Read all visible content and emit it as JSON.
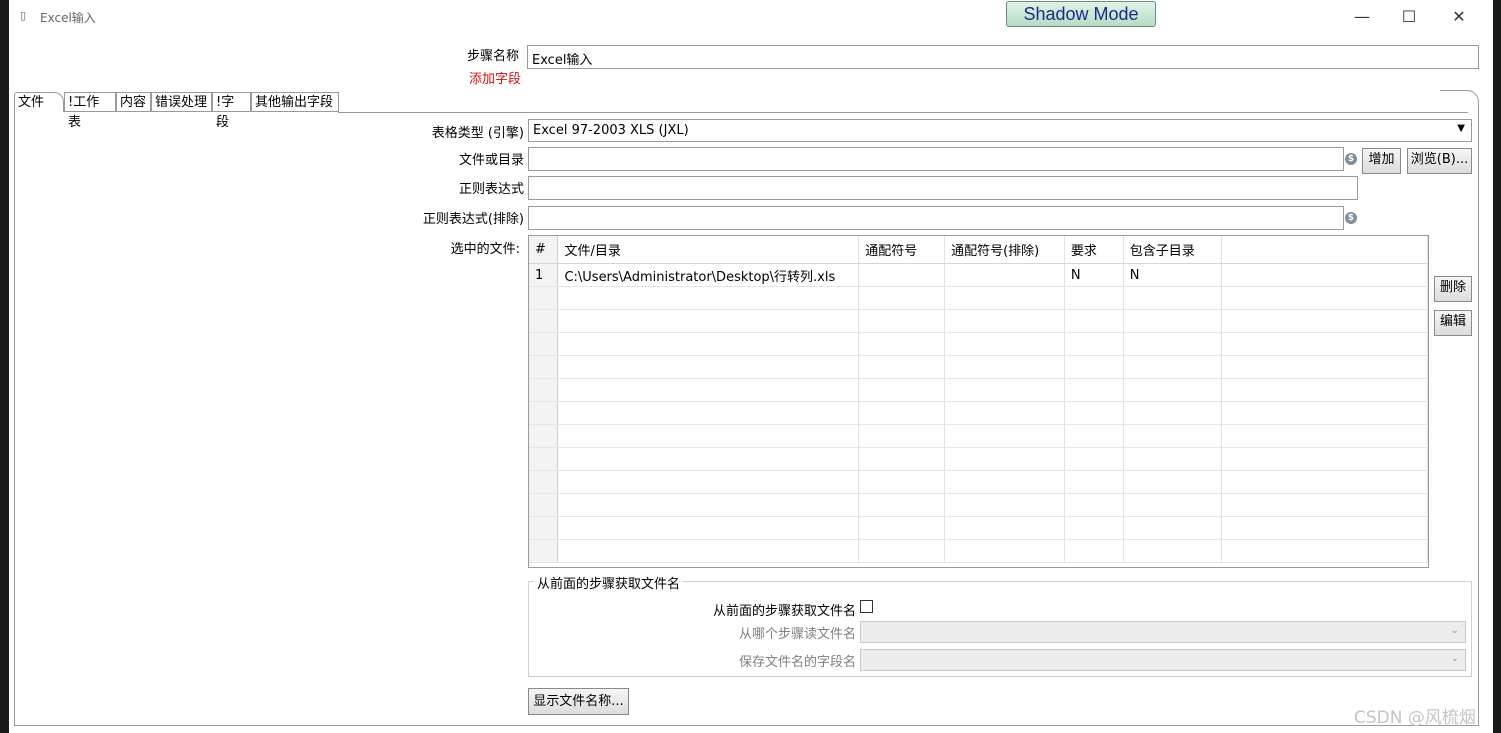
{
  "window": {
    "title": "Excel输入",
    "shadow_mode": "Shadow Mode",
    "minimize": "—",
    "maximize": "☐",
    "close": "✕"
  },
  "step": {
    "name_label": "步骤名称",
    "name_value": "Excel输入",
    "add_field": "添加字段"
  },
  "tabs": [
    {
      "label": "文件"
    },
    {
      "label": "!工作表"
    },
    {
      "label": "内容"
    },
    {
      "label": "错误处理"
    },
    {
      "label": "!字段"
    },
    {
      "label": "其他输出字段"
    }
  ],
  "form": {
    "spreadsheet_type_label": "表格类型 (引擎)",
    "spreadsheet_type_value": "Excel 97-2003 XLS (JXL)",
    "file_or_dir_label": "文件或目录",
    "file_or_dir_value": "",
    "regex_label": "正则表达式",
    "regex_value": "",
    "regex_exclude_label": "正则表达式(排除)",
    "regex_exclude_value": "",
    "add_button": "增加",
    "browse_button": "浏览(B)...",
    "selected_files_label": "选中的文件:",
    "delete_button": "删除",
    "edit_button": "编辑"
  },
  "grid": {
    "columns": [
      "#",
      "文件/目录",
      "通配符号",
      "通配符号(排除)",
      "要求",
      "包含子目录"
    ],
    "rows": [
      [
        "1",
        "C:\\Users\\Administrator\\Desktop\\行转列.xls",
        "",
        "",
        "N",
        "N"
      ]
    ]
  },
  "from_previous": {
    "group_title": "从前面的步骤获取文件名",
    "accept_label": "从前面的步骤获取文件名",
    "accept_checked": false,
    "step_label": "从哪个步骤读文件名",
    "field_label": "保存文件名的字段名"
  },
  "show_filenames_button": "显示文件名称...",
  "watermark": "CSDN @风梳烟"
}
